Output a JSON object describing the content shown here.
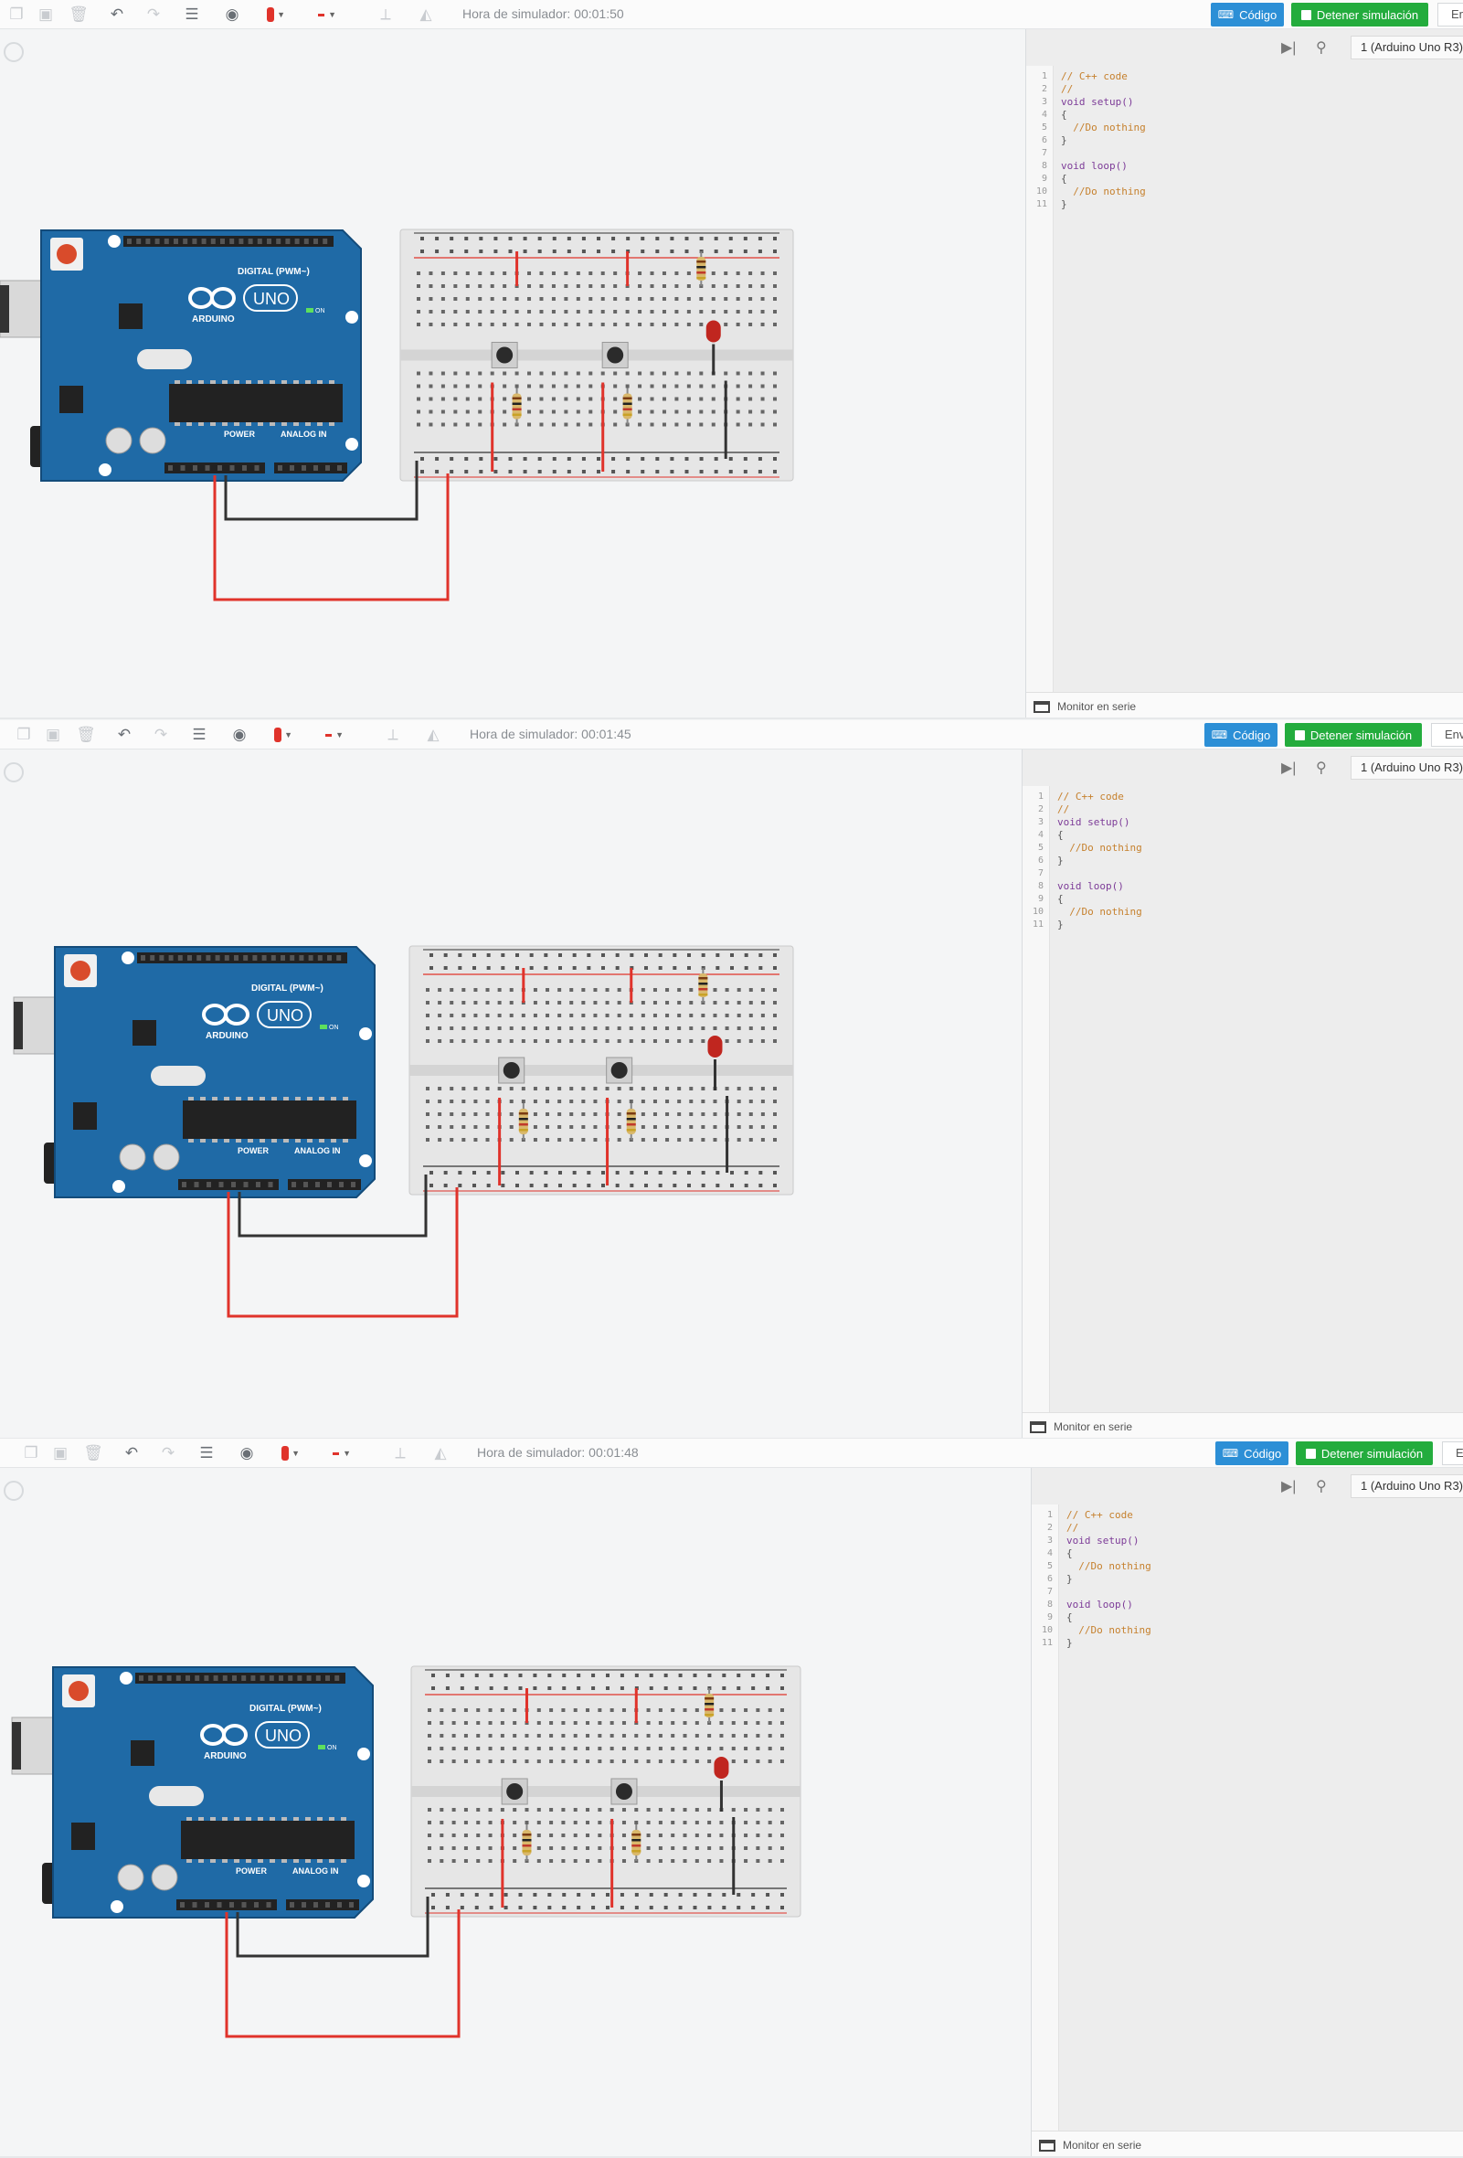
{
  "panels": [
    {
      "sim_time": "Hora de simulador: 00:01:50",
      "code_button": "Código",
      "stop_button": "Detener simulación",
      "extra_button": "Env",
      "device": "1 (Arduino Uno R3)",
      "monitor": "Monitor en serie"
    },
    {
      "sim_time": "Hora de simulador: 00:01:45",
      "code_button": "Código",
      "stop_button": "Detener simulación",
      "extra_button": "Env",
      "device": "1 (Arduino Uno R3)",
      "monitor": "Monitor en serie"
    },
    {
      "sim_time": "Hora de simulador: 00:01:48",
      "code_button": "Código",
      "stop_button": "Detener simulación",
      "extra_button": "Env",
      "device": "1 (Arduino Uno R3)",
      "monitor": "Monitor en serie"
    }
  ],
  "code_lines": [
    "// C++ code",
    "//",
    "void setup()",
    "{",
    "  //Do nothing",
    "}",
    "",
    "void loop()",
    "{",
    "  //Do nothing",
    "}"
  ],
  "line_numbers": [
    "1",
    "2",
    "3",
    "4",
    "5",
    "6",
    "7",
    "8",
    "9",
    "10",
    "11"
  ],
  "board": {
    "brand": "ARDUINO",
    "model": "UNO",
    "digital_label": "DIGITAL (PWM~)",
    "power_label": "POWER",
    "analog_label": "ANALOG IN",
    "on_label": "ON"
  },
  "icons": {
    "copy": "copy-icon",
    "paste": "paste-icon",
    "delete": "trash-icon",
    "undo": "undo-icon",
    "redo": "redo-icon",
    "notes": "notes-icon",
    "view": "eye-icon",
    "color": "color-swatch-icon",
    "wire": "wire-style-icon",
    "rotate": "rotate-icon",
    "flip": "flip-icon",
    "step": "step-icon",
    "debug": "debug-icon",
    "monitor": "serial-monitor-icon"
  },
  "colors": {
    "board": "#1f6aa6",
    "wire_red": "#e0332b",
    "wire_black": "#333333",
    "led": "#c0261f",
    "code_button": "#2c8fd6",
    "stop_button": "#23ac3d"
  }
}
